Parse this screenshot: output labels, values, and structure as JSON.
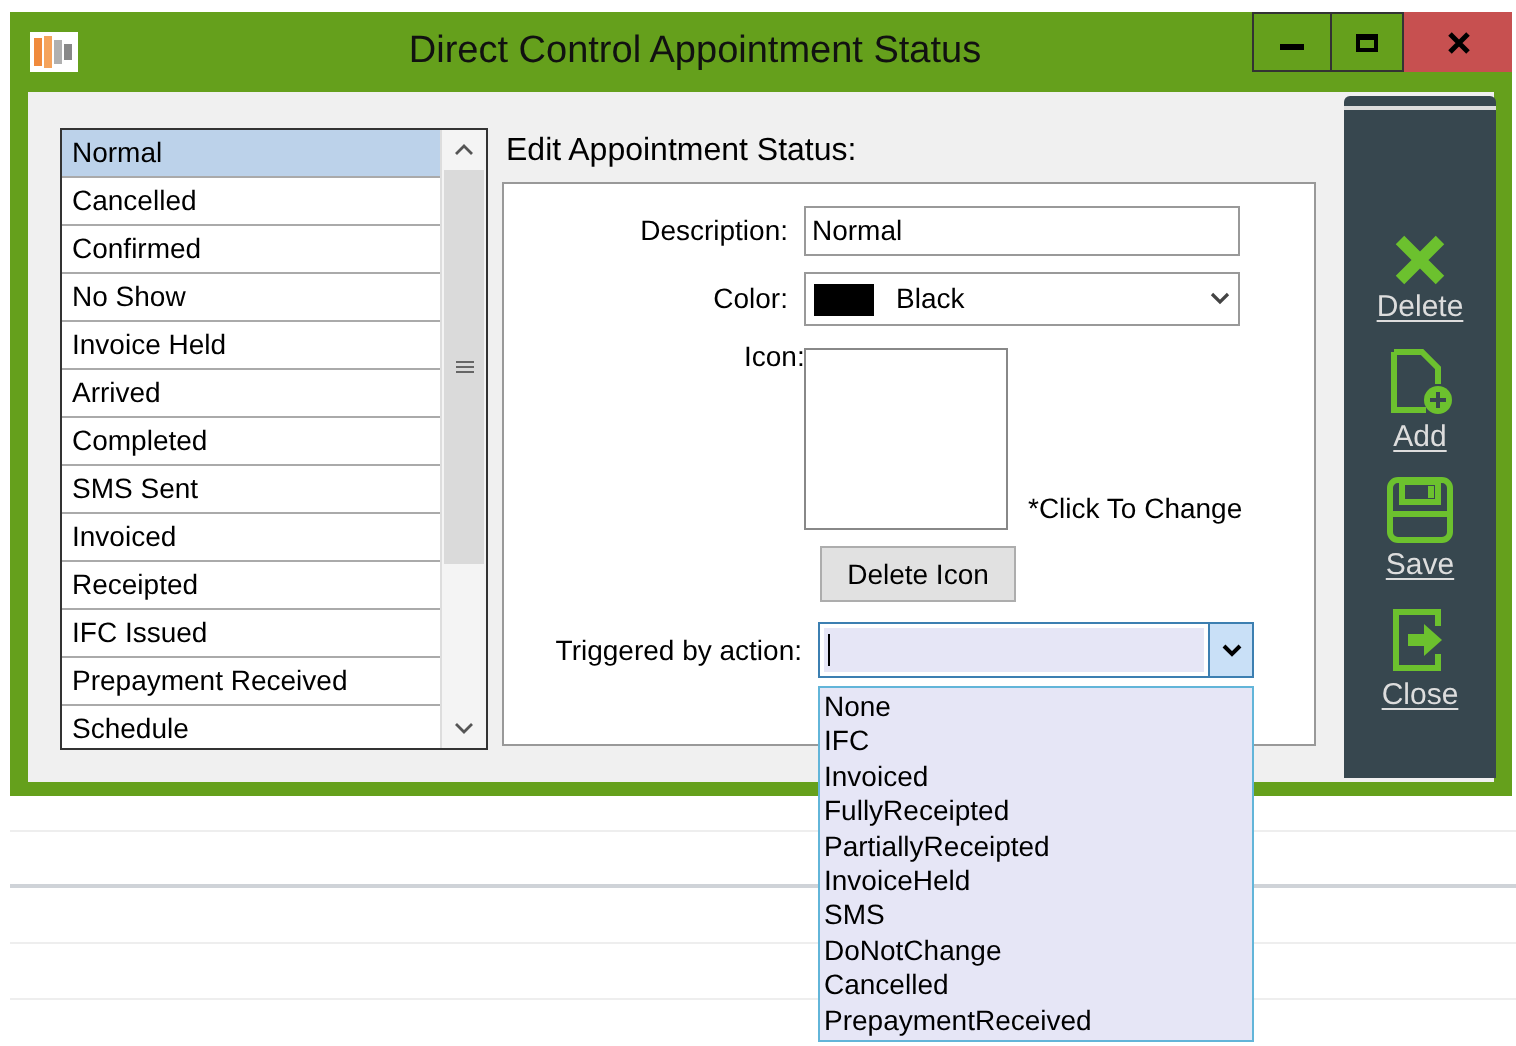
{
  "window": {
    "title": "Direct Control Appointment Status"
  },
  "status_list": {
    "items": [
      {
        "label": "Normal",
        "selected": true
      },
      {
        "label": "Cancelled",
        "selected": false
      },
      {
        "label": "Confirmed",
        "selected": false
      },
      {
        "label": "No Show",
        "selected": false
      },
      {
        "label": "Invoice Held",
        "selected": false
      },
      {
        "label": "Arrived",
        "selected": false
      },
      {
        "label": "Completed",
        "selected": false
      },
      {
        "label": "SMS Sent",
        "selected": false
      },
      {
        "label": "Invoiced",
        "selected": false
      },
      {
        "label": "Receipted",
        "selected": false
      },
      {
        "label": "IFC Issued",
        "selected": false
      },
      {
        "label": "Prepayment Received",
        "selected": false
      },
      {
        "label": "Schedule",
        "selected": false
      }
    ]
  },
  "editor": {
    "heading": "Edit Appointment Status:",
    "description": {
      "label": "Description:",
      "value": "Normal"
    },
    "color": {
      "label": "Color:",
      "value": "Black",
      "color": "#000000"
    },
    "icon": {
      "label": "Icon:",
      "hint": "*Click To Change",
      "delete_button": "Delete Icon"
    },
    "trigger": {
      "label": "Triggered by action:",
      "expanded": true,
      "options": [
        "None",
        "IFC",
        "Invoiced",
        "FullyReceipted",
        "PartiallyReceipted",
        "InvoiceHeld",
        "SMS",
        "DoNotChange",
        "Cancelled",
        "PrepaymentReceived"
      ]
    }
  },
  "actions": [
    {
      "kind": "delete",
      "label": "Delete"
    },
    {
      "kind": "add",
      "label": "Add"
    },
    {
      "kind": "save",
      "label": "Save"
    },
    {
      "kind": "close",
      "label": "Close"
    }
  ]
}
